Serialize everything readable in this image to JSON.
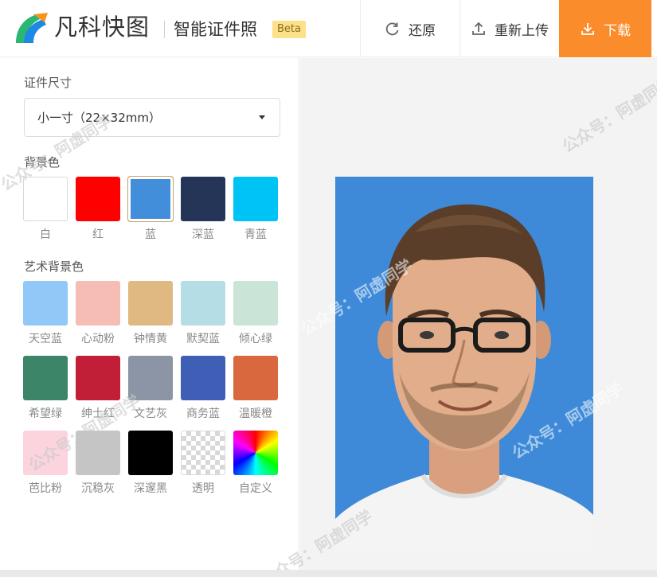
{
  "app": {
    "brand": "凡科快图",
    "product": "智能证件照",
    "beta": "Beta"
  },
  "toolbar": {
    "restore_label": "还原",
    "reupload_label": "重新上传",
    "download_label": "下载",
    "download_color": "#fb8c2c"
  },
  "size": {
    "label": "证件尺寸",
    "selected": "小一寸（22×32mm）"
  },
  "background": {
    "label": "背景色",
    "selected": "蓝",
    "items": [
      {
        "name": "白",
        "color": "#ffffff"
      },
      {
        "name": "红",
        "color": "#ff0000"
      },
      {
        "name": "蓝",
        "color": "#438edb"
      },
      {
        "name": "深蓝",
        "color": "#243558"
      },
      {
        "name": "青蓝",
        "color": "#00c3f5"
      }
    ]
  },
  "art_background": {
    "label": "艺术背景色",
    "items": [
      {
        "name": "天空蓝",
        "color": "#90c8f7"
      },
      {
        "name": "心动粉",
        "color": "#f6bdb5"
      },
      {
        "name": "钟情黄",
        "color": "#dfb882"
      },
      {
        "name": "默契蓝",
        "color": "#b5dde6"
      },
      {
        "name": "倾心绿",
        "color": "#cbe4d8"
      },
      {
        "name": "希望绿",
        "color": "#3c8568"
      },
      {
        "name": "绅士红",
        "color": "#c01f37"
      },
      {
        "name": "文艺灰",
        "color": "#8b95a6"
      },
      {
        "name": "商务蓝",
        "color": "#3f5fb7"
      },
      {
        "name": "温暖橙",
        "color": "#d9683e"
      },
      {
        "name": "芭比粉",
        "color": "#fbd4de"
      },
      {
        "name": "沉稳灰",
        "color": "#c5c5c5"
      },
      {
        "name": "深邃黑",
        "color": "#000000"
      },
      {
        "name": "透明",
        "color": "transparent"
      },
      {
        "name": "自定义",
        "color": "rainbow"
      }
    ]
  },
  "watermarks": {
    "text": "公众号：阿虚同学"
  }
}
